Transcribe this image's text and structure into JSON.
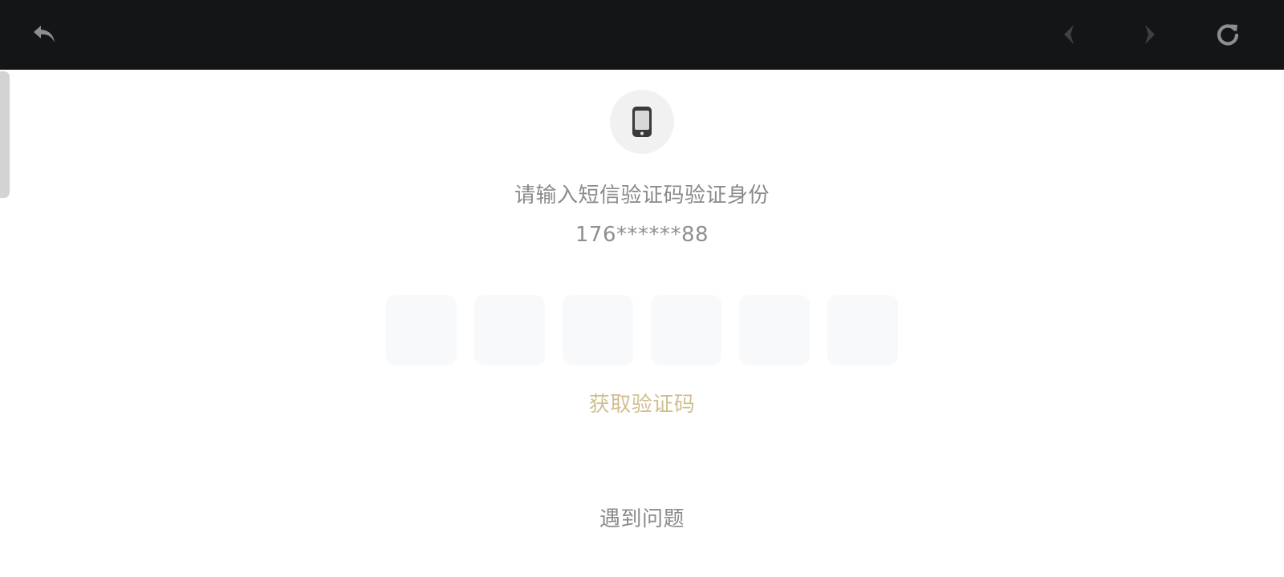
{
  "toolbar": {
    "background": "#141517",
    "icons": {
      "back": "undo-arrow-icon",
      "prev": "chevron-left-icon",
      "next": "chevron-right-icon",
      "refresh": "refresh-icon"
    },
    "icon_color_active": "#8e8e8e",
    "icon_color_disabled": "#3f4043"
  },
  "verify": {
    "icon": "smartphone-icon",
    "prompt": "请输入短信验证码验证身份",
    "phone": "176******88",
    "code_boxes": [
      "",
      "",
      "",
      "",
      "",
      ""
    ],
    "get_code_label": "获取验证码",
    "problem_label": "遇到问题",
    "accent_color": "#d2bf90",
    "text_color": "#8a8a8a"
  }
}
